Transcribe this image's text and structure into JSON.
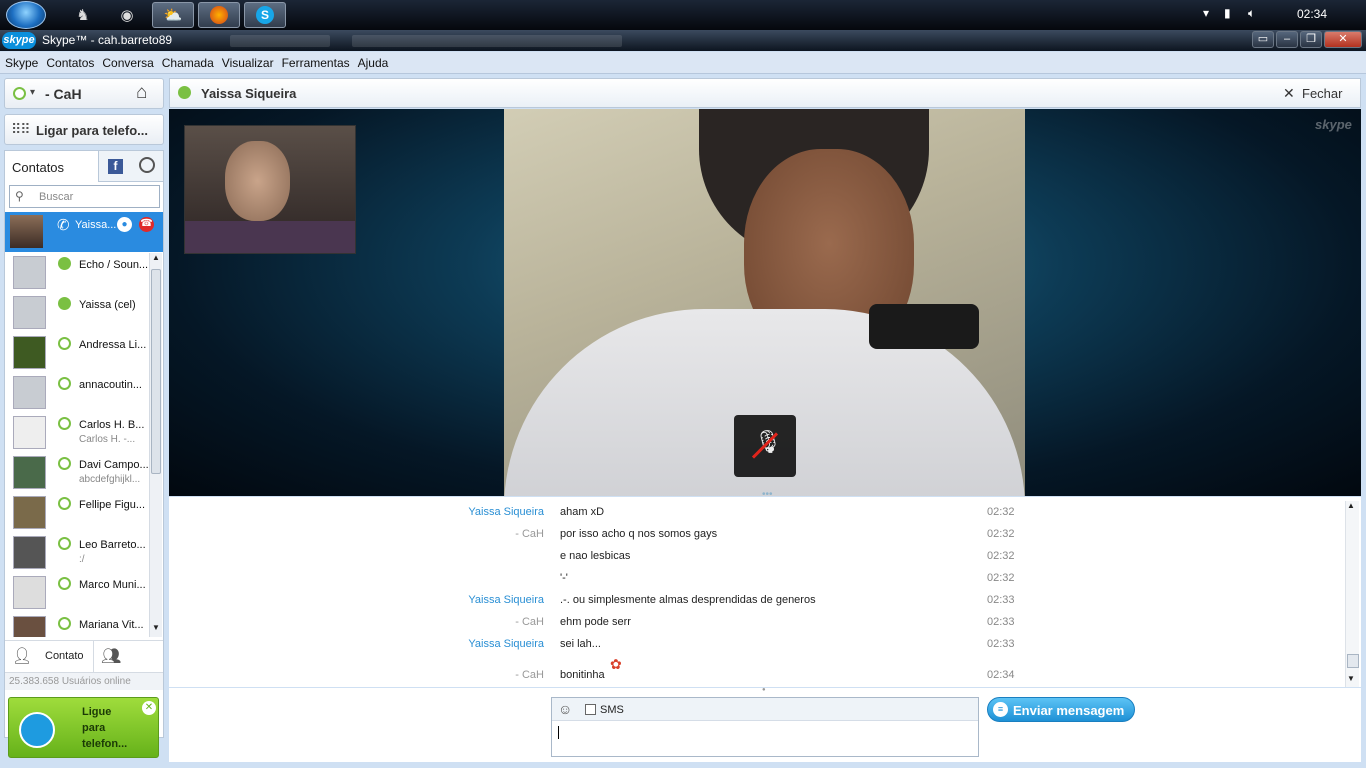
{
  "taskbar": {
    "clock": "02:34"
  },
  "window": {
    "app_logo": "skype",
    "title": "Skype™ - cah.barreto89"
  },
  "menubar": [
    "Skype",
    "Contatos",
    "Conversa",
    "Chamada",
    "Visualizar",
    "Ferramentas",
    "Ajuda"
  ],
  "profile": {
    "name": "- CaH"
  },
  "call_phones": {
    "label": "Ligar para telefo..."
  },
  "contacts_tab": {
    "label": "Contatos"
  },
  "search": {
    "placeholder": "Buscar"
  },
  "contacts": [
    {
      "name": "Yaissa...",
      "sub": "",
      "active": true
    },
    {
      "name": "Echo / Soun...",
      "sub": ""
    },
    {
      "name": "Yaissa (cel)",
      "sub": ""
    },
    {
      "name": "Andressa Li...",
      "sub": ""
    },
    {
      "name": "annacoutin...",
      "sub": ""
    },
    {
      "name": "Carlos H. B...",
      "sub": "Carlos H. -..."
    },
    {
      "name": "Davi Campo...",
      "sub": "abcdefghijkl..."
    },
    {
      "name": "Fellipe  Figu...",
      "sub": ""
    },
    {
      "name": "Leo Barreto...",
      "sub": ":/"
    },
    {
      "name": "Marco Muni...",
      "sub": ""
    },
    {
      "name": "Mariana Vit...",
      "sub": ""
    }
  ],
  "add_contact": {
    "label": "Contato"
  },
  "online_users": "25.383.658 Usuários online",
  "promo": {
    "text_1": "Ligue",
    "text_2": "para",
    "text_3": "telefon..."
  },
  "conversation": {
    "title": "Yaissa Siqueira",
    "close_label": "Fechar",
    "watermark": "skype"
  },
  "messages": [
    {
      "sender": "Yaissa Siqueira",
      "me": false,
      "text": "aham xD",
      "time": "02:32"
    },
    {
      "sender": "- CaH",
      "me": true,
      "text": "por isso acho q nos somos gays",
      "time": "02:32"
    },
    {
      "sender": "",
      "me": true,
      "text": "e nao lesbicas",
      "time": "02:32"
    },
    {
      "sender": "",
      "me": true,
      "text": "'-'",
      "time": "02:32"
    },
    {
      "sender": "Yaissa Siqueira",
      "me": false,
      "text": ".-. ou simplesmente almas desprendidas de generos",
      "time": "02:33"
    },
    {
      "sender": "- CaH",
      "me": true,
      "text": "ehm pode serr",
      "time": "02:33"
    },
    {
      "sender": "Yaissa Siqueira",
      "me": false,
      "text": "sei lah...",
      "time": "02:33"
    },
    {
      "sender": "- CaH",
      "me": true,
      "text": "bonitinha",
      "time": "02:34"
    }
  ],
  "composer": {
    "sms_label": "SMS",
    "send_label": "Enviar mensagem"
  }
}
